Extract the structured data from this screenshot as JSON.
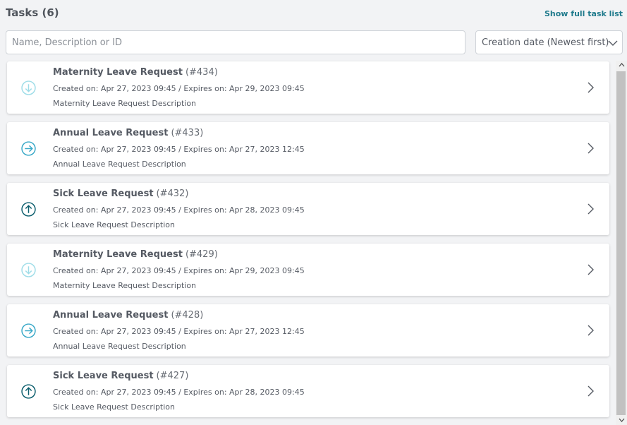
{
  "header": {
    "title": "Tasks (6)",
    "full_list_link": "Show full task list"
  },
  "search": {
    "placeholder": "Name, Description or ID",
    "value": ""
  },
  "sort": {
    "selected": "Creation date (Newest first)"
  },
  "colors": {
    "accent": "#1f7a8c",
    "icon_low": "#9fdde8",
    "icon_normal": "#3aa9c8",
    "icon_high": "#0d5f6e"
  },
  "tasks": [
    {
      "name": "Maternity Leave Request",
      "id": "(#434)",
      "dates": "Created on: Apr 27, 2023 09:45 / Expires on: Apr 29, 2023 09:45",
      "description": "Maternity Leave Request Description",
      "priority_icon": "arrow-down-circle-icon"
    },
    {
      "name": "Annual Leave Request",
      "id": "(#433)",
      "dates": "Created on: Apr 27, 2023 09:45 / Expires on: Apr 27, 2023 12:45",
      "description": "Annual Leave Request Description",
      "priority_icon": "arrow-right-circle-icon"
    },
    {
      "name": "Sick Leave Request",
      "id": "(#432)",
      "dates": "Created on: Apr 27, 2023 09:45 / Expires on: Apr 28, 2023 09:45",
      "description": "Sick Leave Request Description",
      "priority_icon": "arrow-up-circle-icon"
    },
    {
      "name": "Maternity Leave Request",
      "id": "(#429)",
      "dates": "Created on: Apr 27, 2023 09:45 / Expires on: Apr 29, 2023 09:45",
      "description": "Maternity Leave Request Description",
      "priority_icon": "arrow-down-circle-icon"
    },
    {
      "name": "Annual Leave Request",
      "id": "(#428)",
      "dates": "Created on: Apr 27, 2023 09:45 / Expires on: Apr 27, 2023 12:45",
      "description": "Annual Leave Request Description",
      "priority_icon": "arrow-right-circle-icon"
    },
    {
      "name": "Sick Leave Request",
      "id": "(#427)",
      "dates": "Created on: Apr 27, 2023 09:45 / Expires on: Apr 28, 2023 09:45",
      "description": "Sick Leave Request Description",
      "priority_icon": "arrow-up-circle-icon"
    }
  ]
}
